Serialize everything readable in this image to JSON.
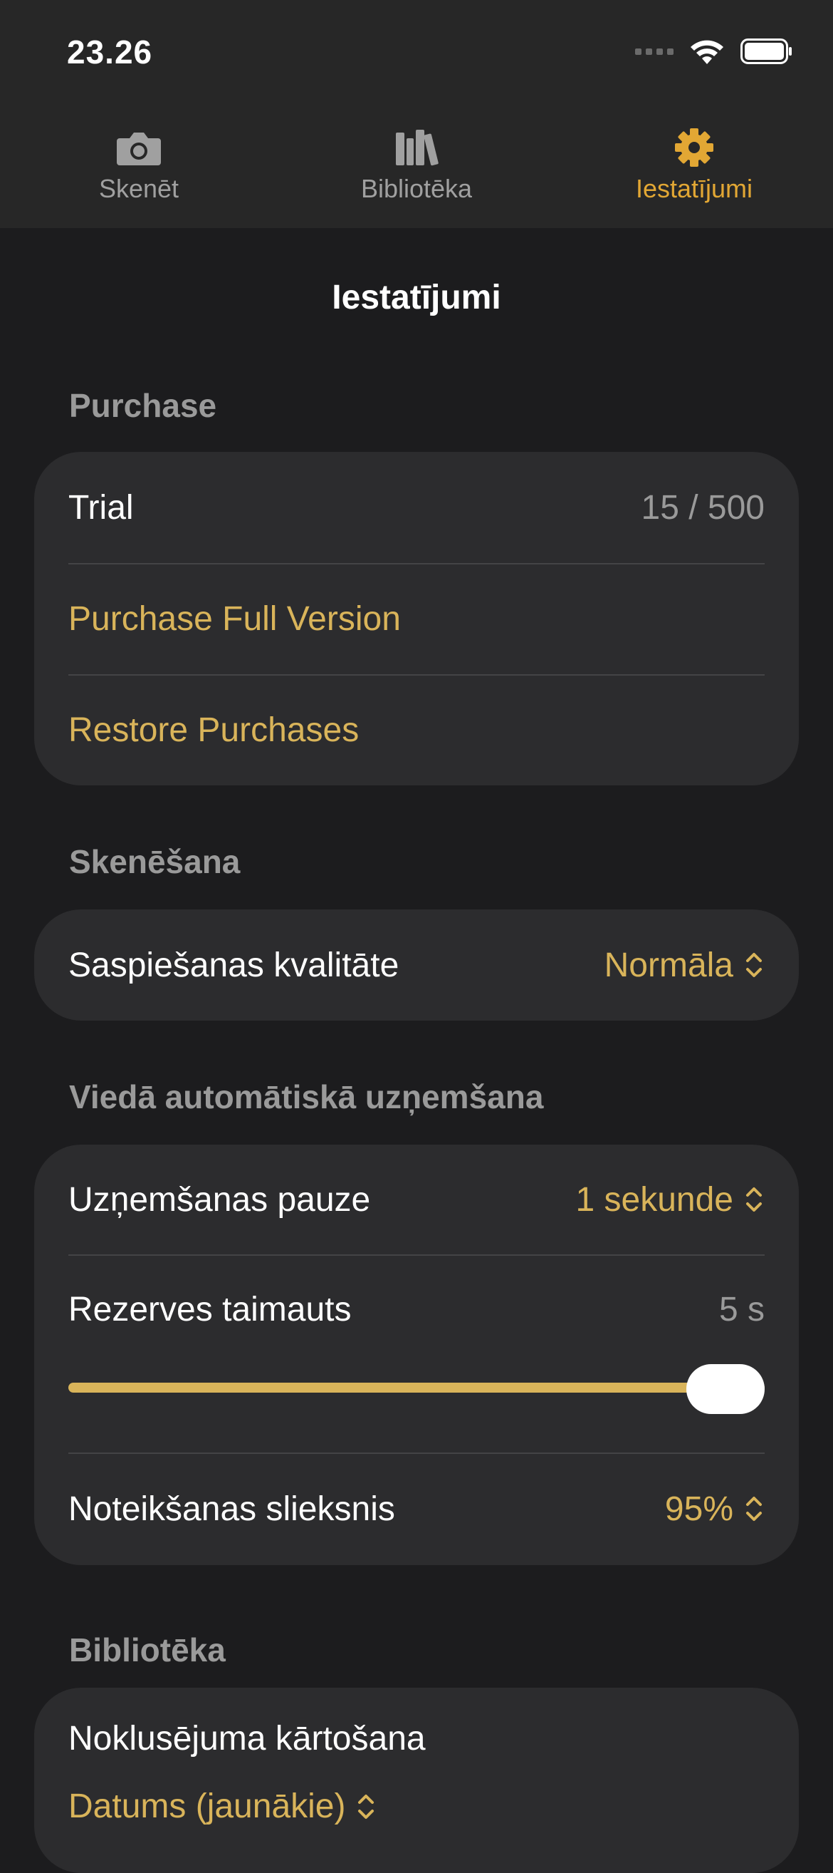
{
  "status_bar": {
    "time": "23.26"
  },
  "tabs": [
    {
      "label": "Skenēt",
      "icon": "camera-icon",
      "active": false
    },
    {
      "label": "Bibliotēka",
      "icon": "library-icon",
      "active": false
    },
    {
      "label": "Iestatījumi",
      "icon": "gear-icon",
      "active": true
    }
  ],
  "page": {
    "title": "Iestatījumi"
  },
  "sections": {
    "purchase": {
      "header": "Purchase",
      "trial_label": "Trial",
      "trial_value": "15 / 500",
      "purchase_full": "Purchase Full Version",
      "restore": "Restore Purchases"
    },
    "scanning": {
      "header": "Skenēšana",
      "compression_label": "Saspiešanas kvalitāte",
      "compression_value": "Normāla"
    },
    "smart_capture": {
      "header": "Viedā automātiskā uzņemšana",
      "pause_label": "Uzņemšanas pauze",
      "pause_value": "1 sekunde",
      "timeout_label": "Rezerves taimauts",
      "timeout_value": "5 s",
      "timeout_slider_fraction": 1.0,
      "threshold_label": "Noteikšanas slieksnis",
      "threshold_value": "95%"
    },
    "library": {
      "header": "Bibliotēka",
      "sort_label": "Noklusējuma kārtošana",
      "sort_value": "Datums (jaunākie)"
    }
  },
  "colors": {
    "accent": "#e2a734",
    "accent_text": "#d9b45a",
    "background": "#1c1c1e",
    "card": "#2c2c2e"
  }
}
